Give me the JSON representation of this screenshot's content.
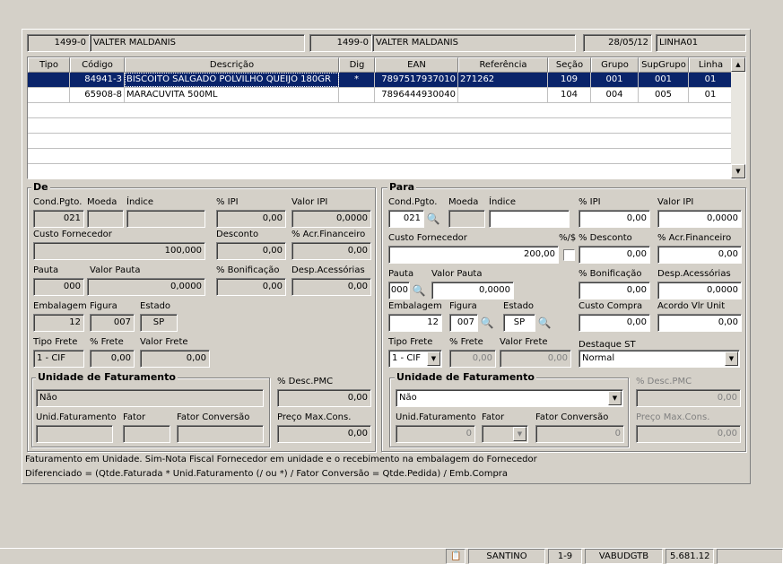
{
  "header": {
    "fornecedor_codigo": "1499-0",
    "fornecedor_nome": "VALTER MALDANIS",
    "fornecedor2_codigo": "1499-0",
    "fornecedor2_nome": "VALTER MALDANIS",
    "data": "28/05/12",
    "linha": "LINHA01"
  },
  "grid": {
    "columns": [
      "Tipo",
      "Código",
      "Descrição",
      "Dig",
      "EAN",
      "Referência",
      "Seção",
      "Grupo",
      "SupGrupo",
      "Linha"
    ],
    "rows": [
      {
        "tipo": "",
        "codigo": "84941-3",
        "descricao": "BISCOITO SALGADO POLVILHO QUEIJO 180GR",
        "dig": "*",
        "ean": "7897517937010",
        "referencia": "271262",
        "secao": "109",
        "grupo": "001",
        "supgrupo": "001",
        "linha": "01",
        "selected": true
      },
      {
        "tipo": "",
        "codigo": "65908-8",
        "descricao": "MARACUVITA 500ML",
        "dig": "",
        "ean": "7896444930040",
        "referencia": "",
        "secao": "104",
        "grupo": "004",
        "supgrupo": "005",
        "linha": "01",
        "selected": false
      }
    ]
  },
  "de": {
    "title": "De",
    "labels": {
      "cond_pgto": "Cond.Pgto.",
      "moeda": "Moeda",
      "indice": "Índice",
      "ipi": "% IPI",
      "valor_ipi": "Valor IPI",
      "custo_fornecedor": "Custo Fornecedor",
      "desconto": "Desconto",
      "acr_financeiro": "% Acr.Financeiro",
      "pauta": "Pauta",
      "valor_pauta": "Valor Pauta",
      "bonificacao": "% Bonificação",
      "desp_acessorias": "Desp.Acessórias",
      "embalagem": "Embalagem",
      "figura": "Figura",
      "estado": "Estado",
      "tipo_frete": "Tipo Frete",
      "perc_frete": "% Frete",
      "valor_frete": "Valor Frete"
    },
    "values": {
      "cond_pgto": "021",
      "moeda": "",
      "indice": "",
      "ipi": "0,00",
      "valor_ipi": "0,0000",
      "custo_fornecedor": "100,000",
      "desconto": "0,00",
      "acr_financeiro": "0,00",
      "pauta": "000",
      "valor_pauta": "0,0000",
      "bonificacao": "0,00",
      "desp_acessorias": "0,00",
      "embalagem": "12",
      "figura": "007",
      "estado": "SP",
      "tipo_frete": "1 - CIF",
      "perc_frete": "0,00",
      "valor_frete": "0,00"
    },
    "unidade": {
      "title": "Unidade de Faturamento",
      "value": "Não",
      "unid_label": "Unid.Faturamento",
      "fator_label": "Fator",
      "conversao_label": "Fator Conversão",
      "unid": "",
      "fator": "",
      "conversao": ""
    },
    "desc_pmc_label": "% Desc.PMC",
    "desc_pmc": "0,00",
    "preco_max_label": "Preço Max.Cons.",
    "preco_max": "0,00"
  },
  "para": {
    "title": "Para",
    "labels": {
      "cond_pgto": "Cond.Pgto.",
      "moeda": "Moeda",
      "indice": "Índice",
      "ipi": "% IPI",
      "valor_ipi": "Valor IPI",
      "custo_fornecedor": "Custo Fornecedor",
      "perc_cifrao": "%/$",
      "desconto": "% Desconto",
      "acr_financeiro": "% Acr.Financeiro",
      "pauta": "Pauta",
      "valor_pauta": "Valor Pauta",
      "bonificacao": "% Bonificação",
      "desp_acessorias": "Desp.Acessórias",
      "embalagem": "Embalagem",
      "figura": "Figura",
      "estado": "Estado",
      "custo_compra": "Custo Compra",
      "acordo": "Acordo Vlr Unit",
      "tipo_frete": "Tipo Frete",
      "perc_frete": "% Frete",
      "valor_frete": "Valor Frete",
      "destaque_st": "Destaque ST"
    },
    "values": {
      "cond_pgto": "021",
      "moeda": "",
      "indice": "",
      "ipi": "0,00",
      "valor_ipi": "0,0000",
      "custo_fornecedor": "200,00",
      "desconto": "0,00",
      "acr_financeiro": "0,00",
      "pauta": "000",
      "valor_pauta": "0,0000",
      "bonificacao": "0,00",
      "desp_acessorias": "0,0000",
      "embalagem": "12",
      "figura": "007",
      "estado": "SP",
      "custo_compra": "0,00",
      "acordo": "0,00",
      "tipo_frete": "1 - CIF",
      "perc_frete": "0,00",
      "valor_frete": "0,00",
      "destaque_st": "Normal"
    },
    "unidade": {
      "title": "Unidade de Faturamento",
      "value": "Não",
      "unid_label": "Unid.Faturamento",
      "fator_label": "Fator",
      "conversao_label": "Fator Conversão",
      "unid": "0",
      "fator": "",
      "conversao": "0"
    },
    "desc_pmc_label": "% Desc.PMC",
    "desc_pmc": "0,00",
    "preco_max_label": "Preço Max.Cons.",
    "preco_max": "0,00"
  },
  "footer_notes": {
    "line1": "Faturamento em Unidade. Sim-Nota Fiscal Fornecedor em unidade e o recebimento na embalagem do Fornecedor",
    "line2": "Diferenciado = (Qtde.Faturada * Unid.Faturamento (/ ou *) / Fator Conversão  = Qtde.Pedida) / Emb.Compra"
  },
  "statusbar": {
    "user": "SANTINO",
    "code": "1-9",
    "db": "VABUDGTB",
    "version": "5.681.12"
  },
  "icons": {
    "binoculars": "binoculars-icon",
    "clipboard": "clipboard-icon"
  }
}
